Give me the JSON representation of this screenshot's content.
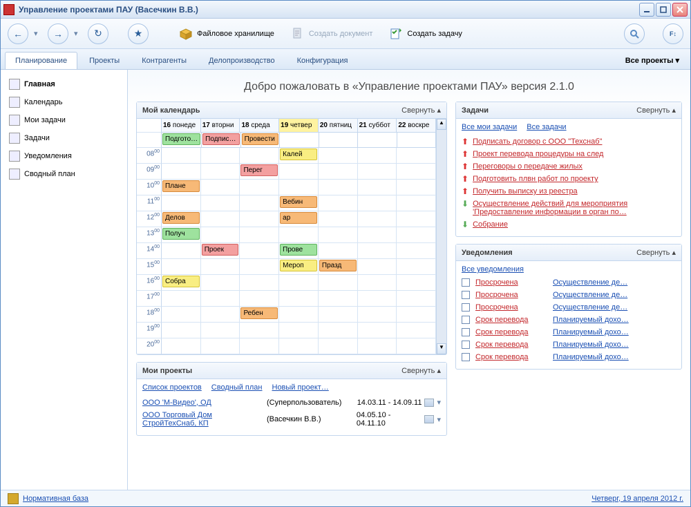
{
  "title": "Управление проектами ПАУ (Васечкин В.В.)",
  "toolbar": {
    "file_storage": "Файловое хранилище",
    "create_doc": "Создать документ",
    "create_task": "Создать задачу"
  },
  "tabs": {
    "planning": "Планирование",
    "projects": "Проекты",
    "contractors": "Контрагенты",
    "paperwork": "Делопроизводство",
    "config": "Конфигурация",
    "all_projects": "Все проекты"
  },
  "sidebar": {
    "items": [
      {
        "label": "Главная"
      },
      {
        "label": "Календарь"
      },
      {
        "label": "Мои задачи"
      },
      {
        "label": "Задачи"
      },
      {
        "label": "Уведомления"
      },
      {
        "label": "Сводный план"
      }
    ]
  },
  "welcome": "Добро пожаловать в «Управление проектами ПАУ» версия 2.1.0",
  "collapse_label": "Свернуть",
  "calendar": {
    "title": "Мой календарь",
    "days": [
      {
        "d": "16",
        "w": "понеде"
      },
      {
        "d": "17",
        "w": "вторни"
      },
      {
        "d": "18",
        "w": "среда"
      },
      {
        "d": "19",
        "w": "четвер",
        "today": true
      },
      {
        "d": "20",
        "w": "пятниц"
      },
      {
        "d": "21",
        "w": "суббот"
      },
      {
        "d": "22",
        "w": "воскре"
      }
    ],
    "allday": [
      {
        "day": 0,
        "text": "Подгото…",
        "cls": "green"
      },
      {
        "day": 1,
        "text": "Подпис…",
        "cls": "red"
      },
      {
        "day": 2,
        "text": "Провести",
        "cls": "orange"
      }
    ],
    "hours": [
      "08",
      "09",
      "10",
      "11",
      "12",
      "13",
      "14",
      "15",
      "16",
      "17",
      "18",
      "19",
      "20"
    ],
    "events": [
      {
        "h": 2,
        "d": 0,
        "text": "Плане",
        "cls": "orange"
      },
      {
        "h": 4,
        "d": 0,
        "text": "Делов",
        "cls": "orange"
      },
      {
        "h": 5,
        "d": 0,
        "text": "Получ",
        "cls": "green"
      },
      {
        "h": 8,
        "d": 0,
        "text": "Собра",
        "cls": "yellow"
      },
      {
        "h": 6,
        "d": 1,
        "text": "Проек",
        "cls": "red"
      },
      {
        "h": 1,
        "d": 2,
        "text": "Перег",
        "cls": "red"
      },
      {
        "h": 10,
        "d": 2,
        "text": "Ребен",
        "cls": "orange"
      },
      {
        "h": 0,
        "d": 3,
        "text": "Калей",
        "cls": "yellow"
      },
      {
        "h": 3,
        "d": 3,
        "text": "Вебин",
        "cls": "orange"
      },
      {
        "h": 4,
        "d": 3,
        "text": "ар",
        "cls": "orange"
      },
      {
        "h": 6,
        "d": 3,
        "text": "Прове",
        "cls": "green"
      },
      {
        "h": 7,
        "d": 3,
        "text": "Мероп",
        "cls": "yellow"
      },
      {
        "h": 7,
        "d": 4,
        "text": "Празд",
        "cls": "orange"
      }
    ]
  },
  "projects_panel": {
    "title": "Мои проекты",
    "links": {
      "list": "Список проектов",
      "summary": "Сводный план",
      "new": "Новый проект…"
    },
    "rows": [
      {
        "name": "ООО 'М-Видео', ОД",
        "owner": "(Суперпользователь)",
        "from": "14.03.11",
        "to": "14.09.11"
      },
      {
        "name": "ООО Торговый Дом СтройТехСнаб, КП",
        "owner": "(Васечкин В.В.)",
        "from": "04.05.10",
        "to": "04.11.10"
      }
    ]
  },
  "tasks_panel": {
    "title": "Задачи",
    "links": {
      "mine": "Все мои задачи",
      "all": "Все задачи"
    },
    "items": [
      {
        "dir": "up",
        "text": "Подписать договор с ООО \"Техснаб\""
      },
      {
        "dir": "up",
        "text": "Проект перевода процедуры на след"
      },
      {
        "dir": "up",
        "text": "Переговоры о передаче жилых"
      },
      {
        "dir": "up",
        "text": "Подготовить плвн работ по проекту"
      },
      {
        "dir": "up",
        "text": "Получить выписку из реестра"
      },
      {
        "dir": "down",
        "text": "Осуществление действий для мероприятия 'Предоставление информации в орган по…"
      },
      {
        "dir": "down",
        "text": "Собрание"
      }
    ]
  },
  "notifications_panel": {
    "title": "Уведомления",
    "all_link": "Все уведомления",
    "items": [
      {
        "status": "Просрочена",
        "action": "Осуществление де…"
      },
      {
        "status": "Просрочена",
        "action": "Осуществление де…"
      },
      {
        "status": "Просрочена",
        "action": "Осуществление де…"
      },
      {
        "status": "Срок перевода",
        "action": "Планируемый дохо…"
      },
      {
        "status": "Срок перевода",
        "action": "Планируемый дохо…"
      },
      {
        "status": "Срок перевода",
        "action": "Планируемый дохо…"
      },
      {
        "status": "Срок перевода",
        "action": "Планируемый дохо…"
      }
    ]
  },
  "statusbar": {
    "left": "Нормативная база",
    "right": "Четверг, 19 апреля 2012 г."
  }
}
